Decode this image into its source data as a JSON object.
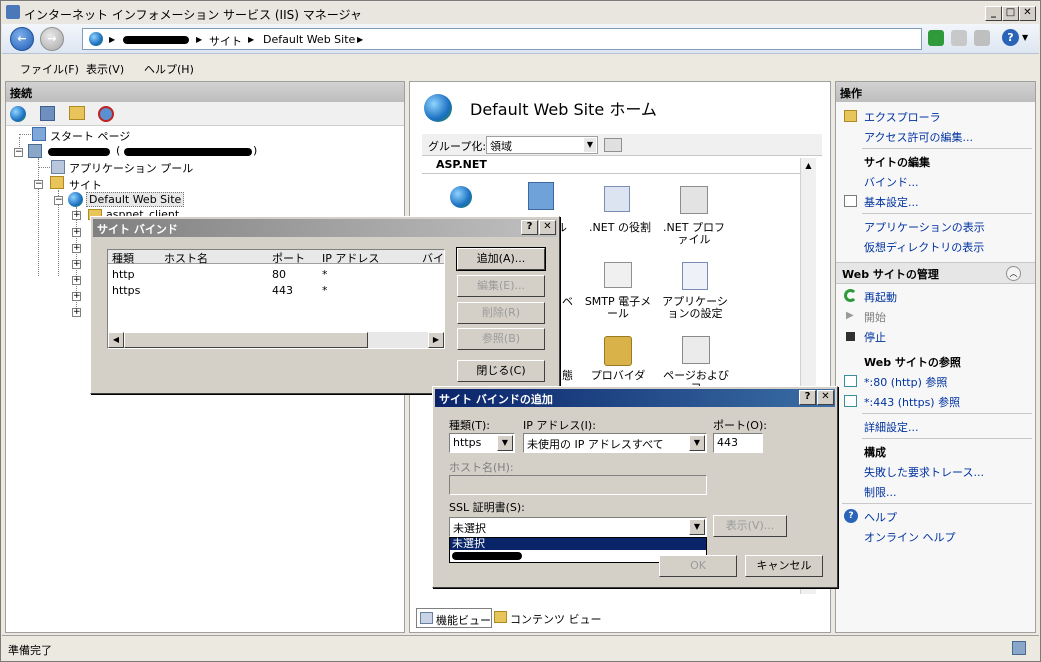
{
  "window": {
    "title": "インターネット インフォメーション サービス (IIS) マネージャ",
    "status": "準備完了"
  },
  "address": {
    "crumbs": [
      "サイト",
      "Default Web Site"
    ]
  },
  "menu": [
    "ファイル(F)",
    "表示(V)",
    "ヘルプ(H)"
  ],
  "connections": {
    "title": "接続",
    "tree": {
      "start_page": "スタート ページ",
      "server_paren": "(",
      "server_paren_close": ")",
      "app_pools": "アプリケーション プール",
      "sites": "サイト",
      "default_site": "Default Web Site",
      "aspnet_client": "aspnet_client"
    }
  },
  "center": {
    "title": "Default Web Site ホーム",
    "group_label": "グループ化:",
    "group_value": "領域",
    "section": "ASP.NET",
    "features": [
      {
        "label": "ル"
      },
      {
        "label": ".NET の役割"
      },
      {
        "label": ".NET プロファイル"
      },
      {
        "label": "ベ"
      },
      {
        "label": "SMTP 電子メール"
      },
      {
        "label": "アプリケーションの設定"
      },
      {
        "label": "態"
      },
      {
        "label": "プロバイダ"
      },
      {
        "label": "ページおよびコ"
      }
    ],
    "tab_features": "機能ビュー",
    "tab_content": "コンテンツ ビュー"
  },
  "actions": {
    "title": "操作",
    "explore": "エクスプローラ",
    "edit_permissions": "アクセス許可の編集...",
    "edit_site_header": "サイトの編集",
    "bindings": "バインド...",
    "basic_settings": "基本設定...",
    "view_apps": "アプリケーションの表示",
    "view_vdirs": "仮想ディレクトリの表示",
    "manage_header": "Web サイトの管理",
    "restart": "再起動",
    "start": "開始",
    "stop": "停止",
    "browse_header": "Web サイトの参照",
    "browse_http": "*:80 (http) 参照",
    "browse_https": "*:443 (https) 参照",
    "advanced": "詳細設定...",
    "config_header": "構成",
    "failed_trace": "失敗した要求トレース...",
    "limits": "制限...",
    "help": "ヘルプ",
    "online_help": "オンライン ヘルプ"
  },
  "site_bindings": {
    "title": "サイト バインド",
    "columns": [
      "種類",
      "ホスト名",
      "ポート",
      "IP アドレス",
      "バイ"
    ],
    "rows": [
      {
        "type": "http",
        "host": "",
        "port": "80",
        "ip": "*"
      },
      {
        "type": "https",
        "host": "",
        "port": "443",
        "ip": "*"
      }
    ],
    "add": "追加(A)...",
    "edit": "編集(E)...",
    "remove": "削除(R)",
    "browse": "参照(B)",
    "close": "閉じる(C)"
  },
  "add_binding": {
    "title": "サイト バインドの追加",
    "type_label": "種類(T):",
    "type_value": "https",
    "ip_label": "IP アドレス(I):",
    "ip_value": "未使用の IP アドレスすべて",
    "port_label": "ポート(O):",
    "port_value": "443",
    "host_label": "ホスト名(H):",
    "host_value": "",
    "ssl_label": "SSL 証明書(S):",
    "ssl_value": "未選択",
    "ssl_options": [
      "未選択"
    ],
    "view_button": "表示(V)...",
    "ok_button": "OK",
    "cancel_button": "キャンセル"
  },
  "colors": {
    "dialog_title": "#0a246a",
    "link": "#0033a0",
    "selection": "#0a246a"
  }
}
